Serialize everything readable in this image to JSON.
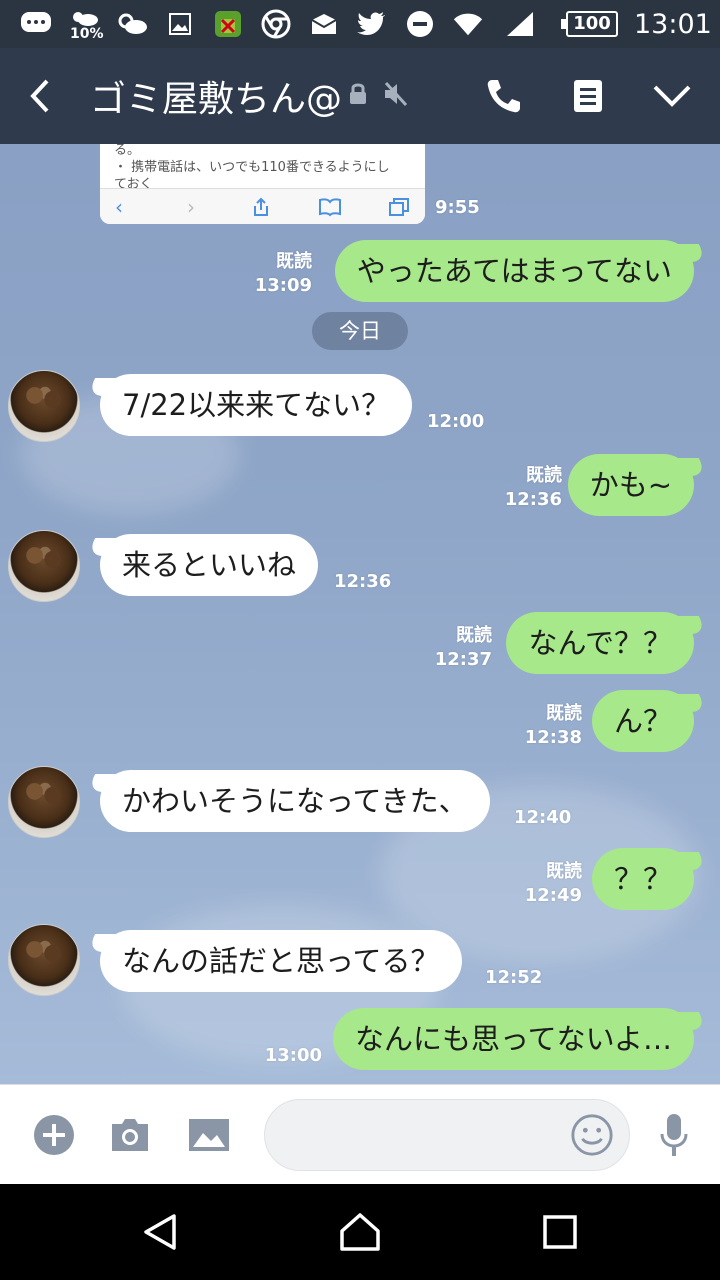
{
  "status_bar": {
    "weather_pct": "10%",
    "battery": "100",
    "time": "13:01"
  },
  "header": {
    "title": "ゴミ屋敷ちん@"
  },
  "preview": {
    "lines": [
      "る。",
      "・ 携帯電話は、いつでも110番できるようにし",
      "ておく"
    ],
    "time": "9:55"
  },
  "date_divider": "今日",
  "messages": [
    {
      "side": "out",
      "text": "やったあてはまってない",
      "read": "既読",
      "time": "13:09"
    },
    {
      "side": "in",
      "text": "7/22以来来てない？",
      "time": "12:00"
    },
    {
      "side": "out",
      "text": "かも~",
      "read": "既読",
      "time": "12:36"
    },
    {
      "side": "in",
      "text": "来るといいね",
      "time": "12:36"
    },
    {
      "side": "out",
      "text": "なんで？？",
      "read": "既読",
      "time": "12:37"
    },
    {
      "side": "out",
      "text": "ん？",
      "read": "既読",
      "time": "12:38"
    },
    {
      "side": "in",
      "text": "かわいそうになってきた、",
      "time": "12:40"
    },
    {
      "side": "out",
      "text": "？？",
      "read": "既読",
      "time": "12:49"
    },
    {
      "side": "in",
      "text": "なんの話だと思ってる？",
      "time": "12:52"
    },
    {
      "side": "out",
      "text": "なんにも思ってないよ…",
      "read": "",
      "time": "13:00"
    }
  ],
  "colors": {
    "header_bg": "#2f3a4d",
    "outgoing_bubble": "#a6e88a",
    "incoming_bubble": "#ffffff",
    "chat_bg": "#8fa6c8"
  }
}
